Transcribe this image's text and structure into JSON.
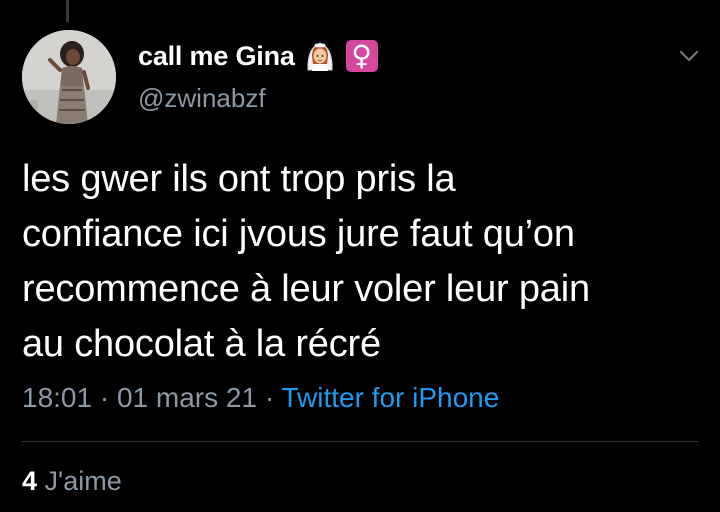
{
  "user": {
    "display_name": "call me Gina",
    "handle": "@zwinabzf",
    "name_emojis": [
      "bride-with-veil-emoji",
      "female-sign-emoji"
    ],
    "female_sign_glyph": "♀"
  },
  "tweet": {
    "text": "les gwer ils ont trop pris la\nconfiance ici jvous jure faut qu’on\nrecommence à leur voler leur pain\nau chocolat à la récré",
    "time": "18:01",
    "date": "01 mars 21",
    "separator": "·",
    "source": "Twitter for iPhone"
  },
  "stats": {
    "likes_count": "4",
    "likes_label": "J'aime"
  },
  "icons": {
    "menu": "chevron-down-icon"
  },
  "colors": {
    "background": "#000000",
    "text": "#ffffff",
    "secondary_text": "#8b98a5",
    "link": "#1d9bf0",
    "divider": "#2f3336",
    "female_sign_bg": "#d6489e"
  }
}
